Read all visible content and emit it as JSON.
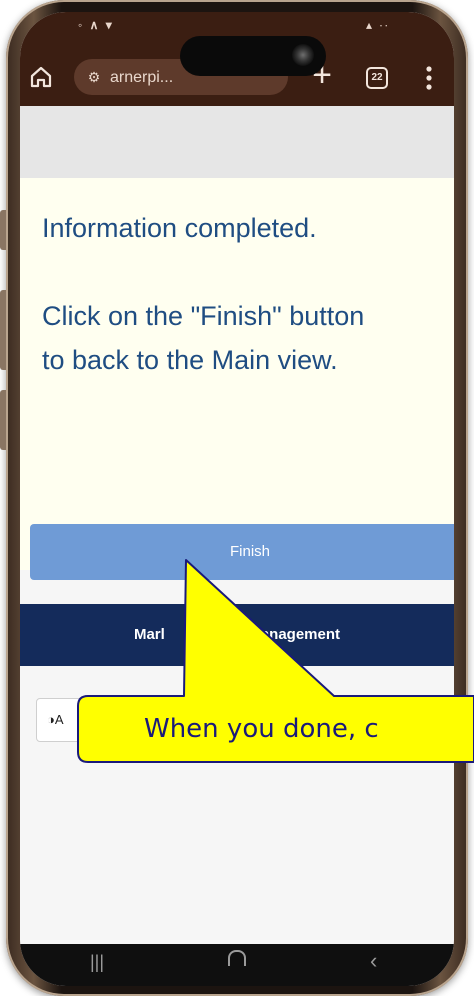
{
  "browser": {
    "url_text": "arnerpi...",
    "tab_count": "22"
  },
  "content": {
    "line1": "Information completed.",
    "line2": "Click on the \"Finish\" button",
    "line3": "to back to the Main view."
  },
  "finish_button": {
    "label": "Finish"
  },
  "footer": {
    "title_left": "Marl",
    "title_right": "anagement"
  },
  "accessibility": {
    "label": "A"
  },
  "callout": {
    "text": "When you done, c"
  },
  "colors": {
    "accent_blue": "#6f9bd6",
    "footer_navy": "#142b5b",
    "text_blue": "#1f4d82",
    "content_bg": "#fffff0",
    "callout_yellow": "#ffff00"
  }
}
